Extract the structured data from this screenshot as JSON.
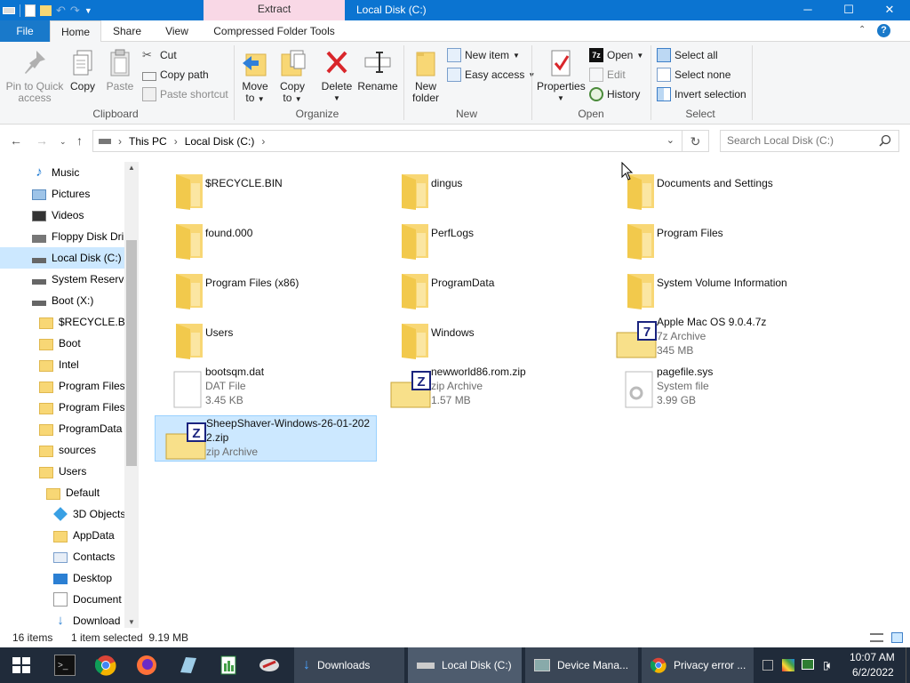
{
  "window": {
    "title": "Local Disk (C:)",
    "context_tab": "Extract",
    "controls": {
      "minimize": "─",
      "maximize": "☐",
      "close": "✕"
    }
  },
  "ribbon_tabs": [
    {
      "label": "File"
    },
    {
      "label": "Home"
    },
    {
      "label": "Share"
    },
    {
      "label": "View"
    },
    {
      "label": "Compressed Folder Tools"
    }
  ],
  "ribbon": {
    "clipboard": {
      "label": "Clipboard",
      "pin": "Pin to Quick",
      "pin2": "access",
      "copy": "Copy",
      "paste": "Paste",
      "cut": "Cut",
      "copy_path": "Copy path",
      "paste_shortcut": "Paste shortcut"
    },
    "organize": {
      "label": "Organize",
      "move_to": "Move",
      "move_to2": "to",
      "copy_to": "Copy",
      "copy_to2": "to",
      "delete": "Delete",
      "rename": "Rename"
    },
    "new": {
      "label": "New",
      "new_folder": "New",
      "new_folder2": "folder",
      "new_item": "New item",
      "easy_access": "Easy access"
    },
    "open": {
      "label": "Open",
      "properties": "Properties",
      "open": "Open",
      "edit": "Edit",
      "history": "History"
    },
    "select": {
      "label": "Select",
      "select_all": "Select all",
      "select_none": "Select none",
      "invert_selection": "Invert selection"
    }
  },
  "address": {
    "crumbs": [
      "This PC",
      "Local Disk (C:)"
    ],
    "search_placeholder": "Search Local Disk (C:)"
  },
  "nav_items": [
    {
      "label": "Music",
      "icon": "music-icon"
    },
    {
      "label": "Pictures",
      "icon": "pictures-icon"
    },
    {
      "label": "Videos",
      "icon": "videos-icon"
    },
    {
      "label": "Floppy Disk Dri",
      "icon": "floppy-icon"
    },
    {
      "label": "Local Disk (C:)",
      "icon": "drive-icon"
    },
    {
      "label": "System Reserve",
      "icon": "drive-icon"
    },
    {
      "label": "Boot (X:)",
      "icon": "drive-icon"
    },
    {
      "label": "$RECYCLE.BIN",
      "icon": "folder-icon"
    },
    {
      "label": "Boot",
      "icon": "folder-icon"
    },
    {
      "label": "Intel",
      "icon": "folder-icon"
    },
    {
      "label": "Program Files",
      "icon": "folder-icon"
    },
    {
      "label": "Program Files",
      "icon": "folder-icon"
    },
    {
      "label": "ProgramData",
      "icon": "folder-icon"
    },
    {
      "label": "sources",
      "icon": "folder-icon"
    },
    {
      "label": "Users",
      "icon": "folder-icon"
    },
    {
      "label": "Default",
      "icon": "folder-icon"
    },
    {
      "label": "3D Objects",
      "icon": "3d-objects-icon"
    },
    {
      "label": "AppData",
      "icon": "folder-icon"
    },
    {
      "label": "Contacts",
      "icon": "contacts-icon"
    },
    {
      "label": "Desktop",
      "icon": "desktop-icon"
    },
    {
      "label": "Document",
      "icon": "documents-icon"
    },
    {
      "label": "Download",
      "icon": "downloads-icon"
    }
  ],
  "files": [
    {
      "name": "$RECYCLE.BIN",
      "type": "",
      "size": "",
      "icon": "folder-icon"
    },
    {
      "name": "dingus",
      "type": "",
      "size": "",
      "icon": "folder-icon"
    },
    {
      "name": "Documents and Settings",
      "type": "",
      "size": "",
      "icon": "folder-shortcut-icon"
    },
    {
      "name": "found.000",
      "type": "",
      "size": "",
      "icon": "folder-icon"
    },
    {
      "name": "PerfLogs",
      "type": "",
      "size": "",
      "icon": "folder-icon"
    },
    {
      "name": "Program Files",
      "type": "",
      "size": "",
      "icon": "folder-icon"
    },
    {
      "name": "Program Files (x86)",
      "type": "",
      "size": "",
      "icon": "folder-icon"
    },
    {
      "name": "ProgramData",
      "type": "",
      "size": "",
      "icon": "folder-icon"
    },
    {
      "name": "System Volume Information",
      "type": "",
      "size": "",
      "icon": "folder-icon"
    },
    {
      "name": "Users",
      "type": "",
      "size": "",
      "icon": "folder-icon"
    },
    {
      "name": "Windows",
      "type": "",
      "size": "",
      "icon": "folder-icon"
    },
    {
      "name": "Apple Mac OS 9.0.4.7z",
      "type": "7z Archive",
      "size": "345 MB",
      "icon": "7z-archive-icon"
    },
    {
      "name": "bootsqm.dat",
      "type": "DAT File",
      "size": "3.45 KB",
      "icon": "file-icon"
    },
    {
      "name": "newworld86.rom.zip",
      "type": "zip Archive",
      "size": "1.57 MB",
      "icon": "zip-archive-icon"
    },
    {
      "name": "pagefile.sys",
      "type": "System file",
      "size": "3.99 GB",
      "icon": "system-file-icon"
    },
    {
      "name": "SheepShaver-Windows-26-01-2022.zip",
      "type": "zip Archive",
      "size": "",
      "icon": "zip-archive-icon"
    }
  ],
  "status": {
    "count": "16 items",
    "selected": "1 item selected  9.19 MB"
  },
  "taskbar": {
    "buttons": [
      {
        "label": "Downloads"
      },
      {
        "label": "Local Disk (C:)"
      },
      {
        "label": "Device Mana..."
      },
      {
        "label": "Privacy error ..."
      }
    ],
    "time": "10:07 AM",
    "date": "6/2/2022"
  },
  "colors": {
    "accent": "#0b74d1",
    "selection": "#cce8ff",
    "folder": "#f8d775",
    "taskbar": "#202b3a"
  }
}
